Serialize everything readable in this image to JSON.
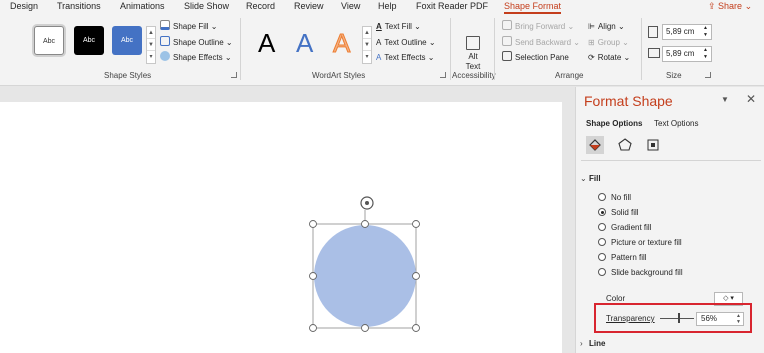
{
  "tabs": [
    {
      "label": "Design",
      "active": false
    },
    {
      "label": "Transitions",
      "active": false
    },
    {
      "label": "Animations",
      "active": false
    },
    {
      "label": "Slide Show",
      "active": false
    },
    {
      "label": "Record",
      "active": false
    },
    {
      "label": "Review",
      "active": false
    },
    {
      "label": "View",
      "active": false
    },
    {
      "label": "Help",
      "active": false
    },
    {
      "label": "Foxit Reader PDF",
      "active": false
    },
    {
      "label": "Shape Format",
      "active": true
    }
  ],
  "share_label": "Share",
  "ribbon": {
    "shape_styles": {
      "gallery": [
        "Abc",
        "Abc",
        "Abc"
      ],
      "fill": "Shape Fill",
      "outline": "Shape Outline",
      "effects": "Shape Effects",
      "label": "Shape Styles"
    },
    "wordart": {
      "samples": [
        "A",
        "A",
        "A"
      ],
      "text_fill": "Text Fill",
      "text_outline": "Text Outline",
      "text_effects": "Text Effects",
      "label": "WordArt Styles"
    },
    "accessibility": {
      "alt_text_line1": "Alt",
      "alt_text_line2": "Text",
      "label": "Accessibility"
    },
    "arrange": {
      "bring_forward": "Bring Forward",
      "send_backward": "Send Backward",
      "selection_pane": "Selection Pane",
      "align": "Align",
      "group": "Group",
      "rotate": "Rotate",
      "label": "Arrange"
    },
    "size": {
      "height": "5,89 cm",
      "width": "5,89 cm",
      "label": "Size"
    }
  },
  "pane": {
    "title": "Format Shape",
    "tabs": [
      "Shape Options",
      "Text Options"
    ],
    "fill_section": "Fill",
    "fill_options": [
      {
        "label": "No fill",
        "selected": false
      },
      {
        "label": "Solid fill",
        "selected": true
      },
      {
        "label": "Gradient fill",
        "selected": false
      },
      {
        "label": "Picture or texture fill",
        "selected": false
      },
      {
        "label": "Pattern fill",
        "selected": false
      },
      {
        "label": "Slide background fill",
        "selected": false
      }
    ],
    "color_label": "Color",
    "transparency_label": "Transparency",
    "transparency_value": "56%",
    "transparency_fraction": 0.56,
    "line_section": "Line"
  },
  "shape_fill_color": "#aabfe6",
  "accent_color": "#c43e1c",
  "highlight_color": "#d8252f"
}
